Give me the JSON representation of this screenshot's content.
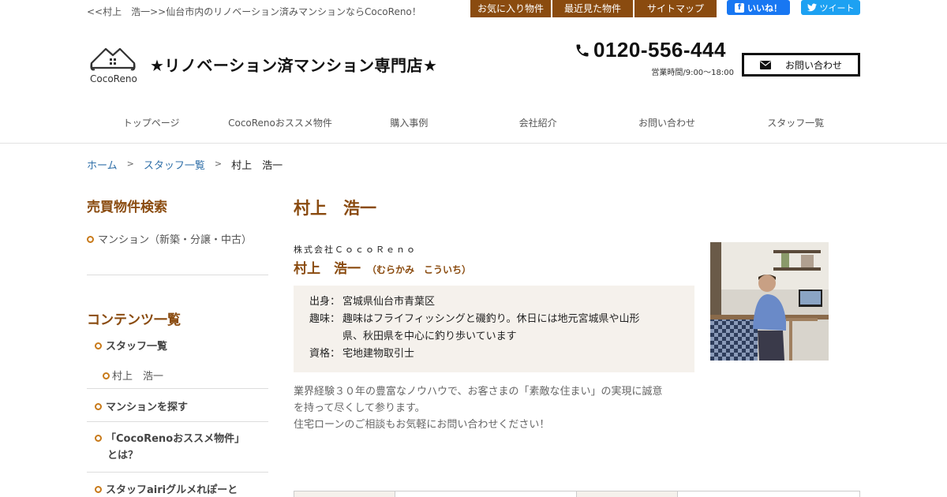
{
  "header": {
    "tagline": "<<村上　浩一>>仙台市内のリノベーション済みマンションならCocoReno！",
    "top_links": [
      "お気に入り物件",
      "最近見た物件",
      "サイトマップ"
    ],
    "fb_label": "いいね！",
    "tw_label": "ツイート",
    "logo_text": "CocoReno",
    "site_title": "★リノベーション済マンション専門店★",
    "phone": "0120-556-444",
    "hours": "営業時間/9:00～18:00",
    "contact_label": "お問い合わせ"
  },
  "nav": [
    "トップページ",
    "CocoRenoおススメ物件",
    "購入事例",
    "会社紹介",
    "お問い合わせ",
    "スタッフ一覧"
  ],
  "breadcrumb": {
    "home": "ホーム",
    "sep": ">",
    "staff_list": "スタッフ一覧",
    "current": "村上　浩一"
  },
  "sidebar": {
    "search_heading": "売買物件検索",
    "search_link": "マンション（新築・分譲・中古）",
    "contents_heading": "コンテンツ一覧",
    "staff_list": "スタッフ一覧",
    "staff_current": "村上　浩一",
    "find_mansion": "マンションを探す",
    "recommend_line1": "「CocoRenoおススメ物件」",
    "recommend_line2": "とは？",
    "gourmet": "スタッフairiグルメれぽーと"
  },
  "main": {
    "title": "村上　浩一",
    "company": "株式会社ＣｏｃｏＲｅｎｏ",
    "name": "村上　浩一",
    "kana": "（むらかみ　こういち）",
    "profile": {
      "origin_label": "出身：",
      "origin": "宮城県仙台市青葉区",
      "hobby_label": "趣味：",
      "hobby_line1": "趣味はフライフィッシングと磯釣り。休日には地元宮城県や山形",
      "hobby_line2": "県、秋田県を中心に釣り歩いています",
      "license_label": "資格：",
      "license": "宅地建物取引士"
    },
    "bio_line1": "業界経験３０年の豊富なノウハウで、お客さまの「素敵な住まい」の実現に誠意",
    "bio_line2": "を持って尽くして参ります。",
    "bio_line3": "住宅ローンのご相談もお気軽にお問い合わせください！"
  },
  "colors": {
    "brand_brown": "#8a4b0f",
    "bullet_orange": "#c87a1a",
    "link_blue": "#2f6fa8",
    "profile_bg": "#f5f1ec"
  }
}
